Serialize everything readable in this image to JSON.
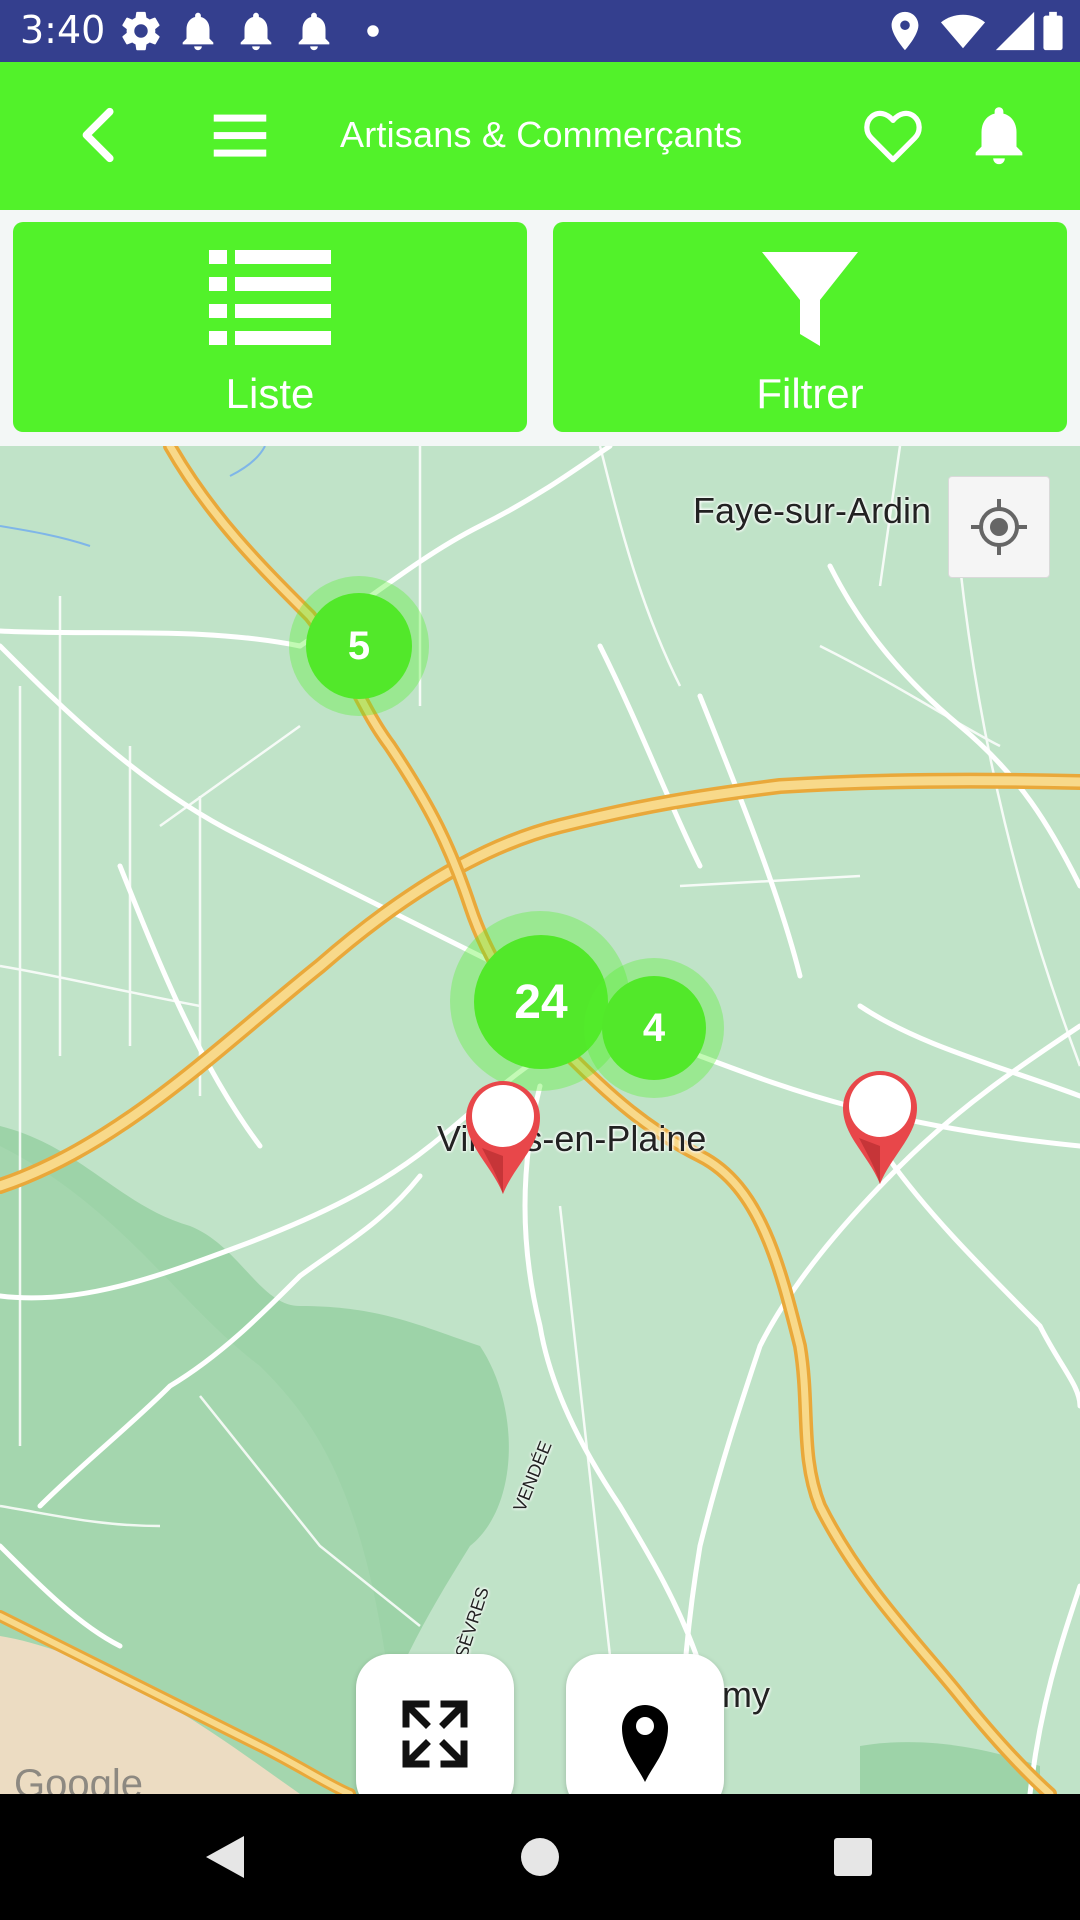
{
  "status_bar": {
    "time": "3:40",
    "icons_left": [
      "gear-icon",
      "bell-icon",
      "bell-icon",
      "bell-icon",
      "dot-icon"
    ],
    "icons_right": [
      "location-icon",
      "wifi-icon",
      "signal-icon",
      "battery-icon"
    ]
  },
  "toolbar": {
    "title": "Artisans & Commerçants",
    "color": "#52f22a"
  },
  "tabs": {
    "list_label": "Liste",
    "filter_label": "Filtrer"
  },
  "map": {
    "places": [
      "Faye-sur-Ardin",
      "Villiers-en-Plaine",
      "my"
    ],
    "road_labels": [
      "VENDÉE",
      "SÈVRES"
    ],
    "clusters": [
      {
        "count": "5"
      },
      {
        "count": "24"
      },
      {
        "count": "4"
      }
    ],
    "watermark": "Google"
  },
  "colors": {
    "status_bar": "#343f8e",
    "accent": "#52f22a",
    "marker": "#e8474a"
  }
}
